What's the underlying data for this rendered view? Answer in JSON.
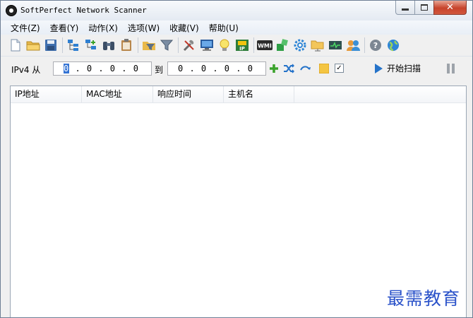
{
  "window": {
    "title": "SoftPerfect Network Scanner",
    "close_glyph": "✕"
  },
  "menu": {
    "items": [
      {
        "label": "文件(Z)"
      },
      {
        "label": "查看(Y)"
      },
      {
        "label": "动作(X)"
      },
      {
        "label": "选项(W)"
      },
      {
        "label": "收藏(V)"
      },
      {
        "label": "帮助(U)"
      }
    ]
  },
  "toolbar": {
    "icons": [
      "new-document-icon",
      "open-folder-icon",
      "save-icon",
      "expand-tree-icon",
      "collapse-tree-icon",
      "binoculars-icon",
      "clipboard-icon",
      "filter-icon",
      "filter-funnel-icon",
      "tools-icon",
      "remote-computer-icon",
      "lightbulb-icon",
      "ip-address-icon",
      "wmi-icon",
      "registry-icon",
      "settings-gear-icon",
      "shared-folder-icon",
      "network-monitor-icon",
      "users-icon",
      "help-icon",
      "web-globe-icon"
    ],
    "wmi_label": "WMI",
    "ip_label": "IP"
  },
  "scan": {
    "range_label": "IPv4 从",
    "from_ip": "0 . 0 . 0 . 0",
    "to_label": "到",
    "to_ip": "0 . 0 . 0 . 0",
    "start_label": "开始扫描",
    "checkbox_checked": true
  },
  "table": {
    "columns": [
      "IP地址",
      "MAC地址",
      "响应时间",
      "主机名"
    ],
    "rows": []
  },
  "watermark": "最需教育",
  "colors": {
    "accent": "#2573c9",
    "add_green": "#3aa22b",
    "watermark": "#2a52c9"
  }
}
